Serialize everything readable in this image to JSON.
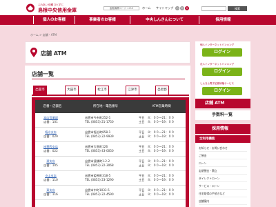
{
  "header": {
    "tagline": "ふれあい 信頼 ひとすじ",
    "bank_name": "島根中央信用金庫",
    "bank_code": "金融機関コード 1713",
    "home": "ホーム",
    "sitemap": "サイトマップ",
    "font_sizes": [
      "小",
      "中",
      "大"
    ],
    "search_placeholder": "",
    "search_button": "検索"
  },
  "nav": [
    "個人のお客様",
    "事業者のお客様",
    "中央しんきんについて",
    "採用情報"
  ],
  "breadcrumb": "ホーム > 店舗・ATM",
  "page_title": "店舗 ATM",
  "section_heading": "店舗一覧",
  "tabs": [
    "出雲市",
    "大田市",
    "松江市",
    "江津市",
    "邑智郡"
  ],
  "table": {
    "headers": [
      "店番・店舗名",
      "所在地・電話番号",
      "ATM営業時間"
    ],
    "rows": [
      {
        "name": "本店営業部",
        "code": "店番：101",
        "addr": "出雲市今市町252-1",
        "tel": "TEL (0853) 21-1750",
        "h1": "平日　８：００～21：００",
        "h2": "土日　８：００～19：００"
      },
      {
        "name": "塩冶支店",
        "code": "店番：029",
        "addr": "出雲市塩冶町858-1",
        "tel": "TEL (0853) 22-9939",
        "h1": "平日　８：００～21：００",
        "h2": "土日　８：００～19：００"
      },
      {
        "name": "出雲西支店",
        "code": "店番：022",
        "addr": "出雲市大島町126",
        "tel": "TEL (0853) 43-0050",
        "h1": "平日　８：００～21：００",
        "h2": "土日　８：００～19：００"
      },
      {
        "name": "渡支店",
        "code": "店番：105",
        "addr": "出雲市渡橋町1-2-2",
        "tel": "TEL (0853) 22-3068",
        "h1": "平日　８：００～21：００",
        "h2": "土日　８：００～19：００"
      },
      {
        "name": "小山支店",
        "code": "店番：110",
        "addr": "出雲市姫原町318-5",
        "tel": "TEL (0853) 23-1290",
        "h1": "平日　８：００～21：００",
        "h2": "土日　８：００～19：００"
      },
      {
        "name": "東支店",
        "code": "店番：116",
        "addr": "出雲市中町1033-5",
        "tel": "TEL (0853) 22-4590",
        "h1": "平日　８：００～21：００",
        "h2": "土日　８：００～19：００"
      }
    ]
  },
  "sidebar": {
    "login1_label": "個人インターネットバンキング",
    "login2_label": "法人インターネットバンキング",
    "login3_label": "しんきん電子記録債権サービス",
    "login_button": "ログイン",
    "atm": "店舗 ATM",
    "fees": "手数料一覧",
    "recruit": "採用情報",
    "menu_title": "全利用機能",
    "menu_items": [
      "お知らせ・お問い合わせ",
      "ご預金",
      "ローン",
      "定期預金・積立",
      "ダイレクトローン",
      "サービス・ローン",
      "住宅取得の手続きなど",
      "店舗案内",
      "マネー・ローンが使える手続き",
      "マネー・ローン他"
    ]
  },
  "colors": {
    "accent": "#b8072e",
    "green": "#7bb318",
    "pink": "#f6d9df",
    "dark": "#3a3a3a"
  }
}
